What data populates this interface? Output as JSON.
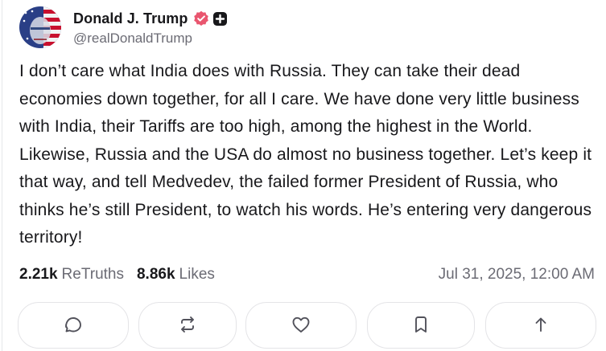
{
  "author": {
    "name": "Donald J. Trump",
    "handle": "@realDonaldTrump",
    "avatar_icon": "avatar-flag-portrait",
    "verified_icon": "verified-badge-icon",
    "verified_color": "#e9566f",
    "plus_icon": "plus-badge-icon"
  },
  "post": {
    "text": "I don’t care what India does with Russia. They can take their dead economies down together, for all I care. We have done very little business with India, their Tariffs are too high, among the highest in the World. Likewise, Russia and the USA do almost no business together. Let’s keep it that way, and tell Medvedev, the failed former President of Russia, who thinks he’s still President, to watch his words. He’s entering very dangerous territory!",
    "retruths_count": "2.21k",
    "retruths_label": "ReTruths",
    "likes_count": "8.86k",
    "likes_label": "Likes",
    "timestamp": "Jul 31, 2025, 12:00 AM"
  },
  "actions": [
    {
      "name": "reply-button",
      "icon": "reply-icon"
    },
    {
      "name": "retruth-button",
      "icon": "retruth-icon"
    },
    {
      "name": "like-button",
      "icon": "heart-icon"
    },
    {
      "name": "bookmark-button",
      "icon": "bookmark-icon"
    },
    {
      "name": "share-button",
      "icon": "share-icon"
    }
  ]
}
